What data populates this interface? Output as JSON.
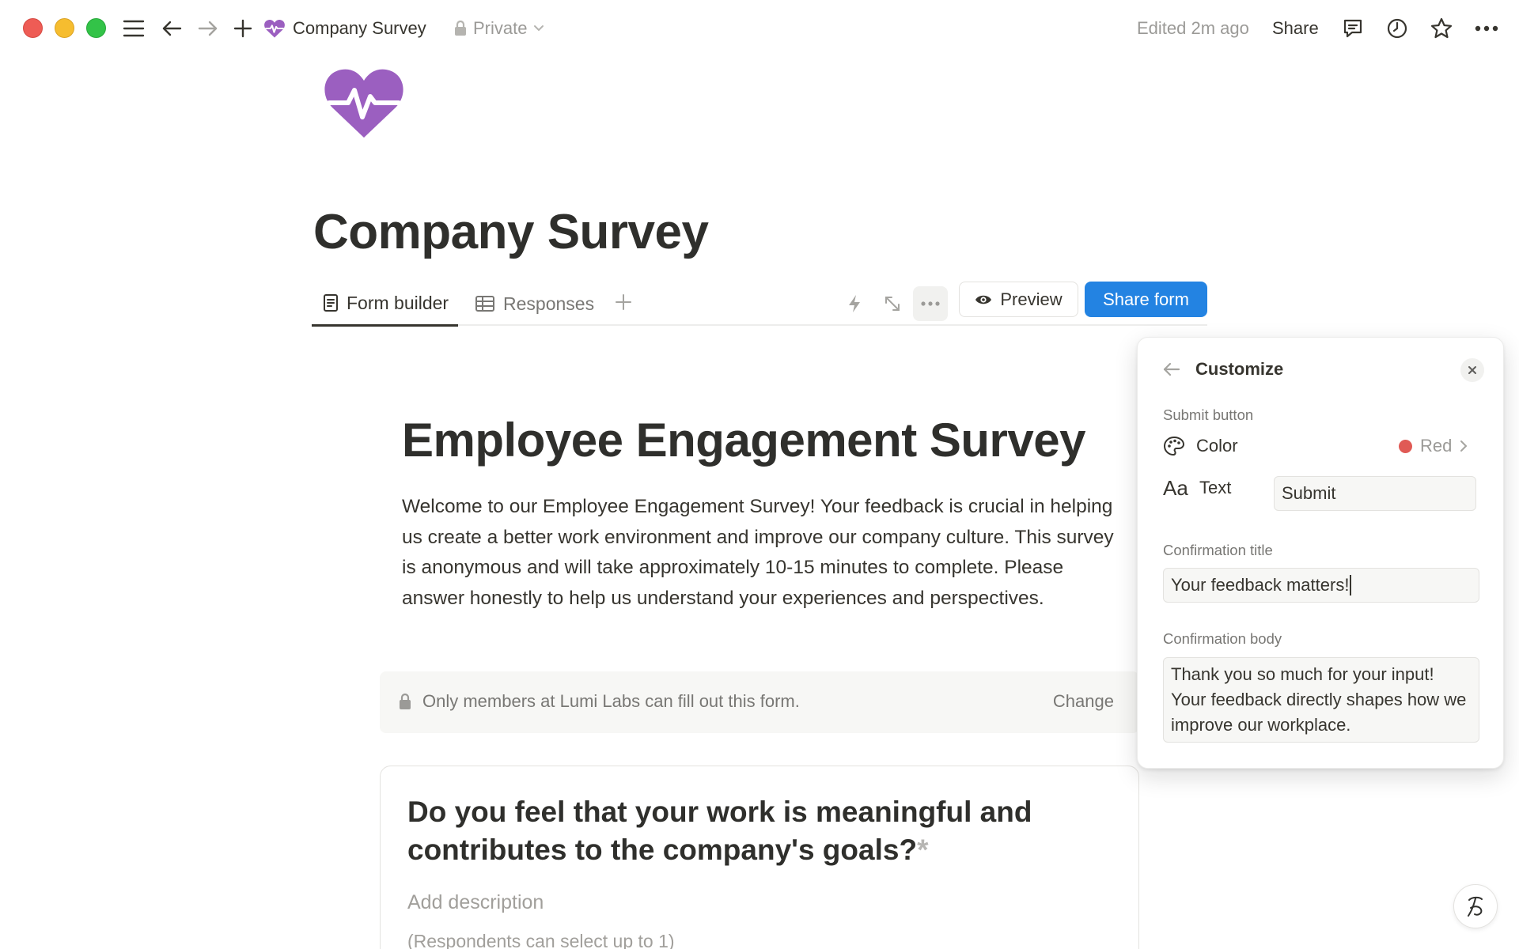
{
  "window": {
    "breadcrumb_title": "Company Survey",
    "privacy": "Private",
    "edited": "Edited 2m ago",
    "share": "Share"
  },
  "page": {
    "title": "Company Survey",
    "icon": "heart-pulse-icon",
    "icon_color": "#9b5fc0"
  },
  "tabs": {
    "form_builder": "Form builder",
    "responses": "Responses",
    "preview": "Preview",
    "share_form": "Share form"
  },
  "form": {
    "title": "Employee Engagement Survey",
    "description": "Welcome to our Employee Engagement Survey! Your feedback is crucial in helping us create a better work environment and improve our company culture. This survey is anonymous and will take approximately 10-15 minutes to complete. Please answer honestly to help us understand your experiences and perspectives.",
    "access_text": "Only members at Lumi Labs can fill out this form.",
    "access_change": "Change"
  },
  "question": {
    "title": "Do you feel that your work is meaningful and contributes to the company's goals?",
    "required_mark": "*",
    "description_placeholder": "Add description",
    "hint": "(Respondents can select up to 1)"
  },
  "customize": {
    "title": "Customize",
    "submit_section": "Submit button",
    "color_label": "Color",
    "color_value": "Red",
    "color_hex": "#e05a55",
    "text_label": "Text",
    "text_value": "Submit",
    "confirmation_title_label": "Confirmation title",
    "confirmation_title_value": "Your feedback matters!",
    "confirmation_body_label": "Confirmation body",
    "confirmation_body_value": "Thank you so much for your input! Your feedback directly shapes how we improve our workplace."
  },
  "colors": {
    "accent": "#2383e2",
    "text": "#37352f",
    "muted": "#787774"
  }
}
